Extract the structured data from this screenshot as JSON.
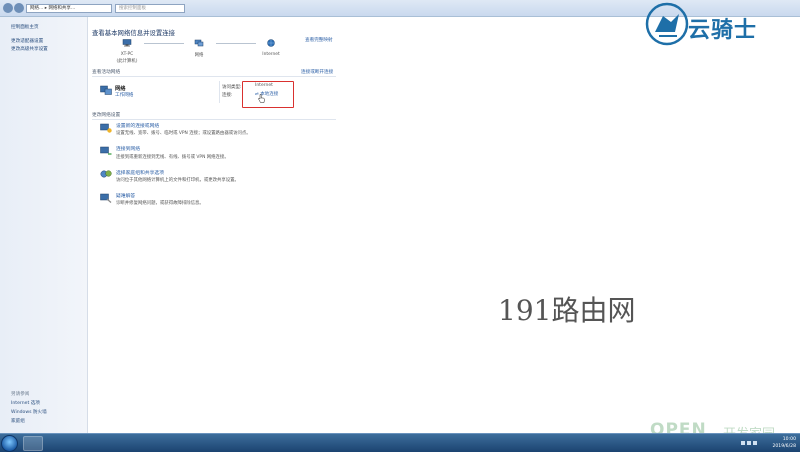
{
  "address_bar": {
    "path_segments": [
      "网络...",
      "网络和共享..."
    ],
    "search_placeholder": "搜索控制面板"
  },
  "left_pane": {
    "links": [
      "控制面板主页",
      "更改适配器设置",
      "更改高级共享设置"
    ],
    "see_also_heading": "另请参阅",
    "see_also_links": [
      "Internet 选项",
      "Windows 防火墙",
      "家庭组"
    ]
  },
  "main": {
    "title": "查看基本网络信息并设置连接",
    "view_full_map": "查看完整映射",
    "map_nodes": [
      {
        "label": "XT-PC",
        "sublabel": "(此计算机)"
      },
      {
        "label": "网络",
        "sublabel": ""
      },
      {
        "label": "Internet",
        "sublabel": ""
      }
    ],
    "active_networks_heading": "查看活动网络",
    "connect_disconnect": "连接或断开连接",
    "network": {
      "name": "网络",
      "type": "工作网络",
      "access_type_label": "访问类型:",
      "access_type_value": "Internet",
      "connections_label": "连接:",
      "connection_value": "本地连接"
    },
    "change_settings_heading": "更改网络设置",
    "tasks": [
      {
        "title": "设置新的连接或网络",
        "desc": "设置无线、宽带、拨号、临时或 VPN 连接；或设置路由器或访问点。",
        "icon": "new-connection-icon"
      },
      {
        "title": "连接到网络",
        "desc": "连接到或重新连接到无线、有线、拨号或 VPN 网络连接。",
        "icon": "connect-network-icon"
      },
      {
        "title": "选择家庭组和共享选项",
        "desc": "访问位于其他网络计算机上的文件和打印机，或更改共享设置。",
        "icon": "homegroup-icon"
      },
      {
        "title": "疑难解答",
        "desc": "诊断并修复网络问题，或获得故障排除信息。",
        "icon": "troubleshoot-icon"
      }
    ]
  },
  "overlays": {
    "logo_text": "云骑士",
    "watermark": "191路由网",
    "brand_latin": "OPEN",
    "brand_cn": "开发家园"
  },
  "taskbar": {
    "time": "10:00",
    "date": "2019/6/28"
  },
  "colors": {
    "link": "#2b5fa6",
    "highlight_box": "#d9312f",
    "taskbar": "#1b4370"
  }
}
